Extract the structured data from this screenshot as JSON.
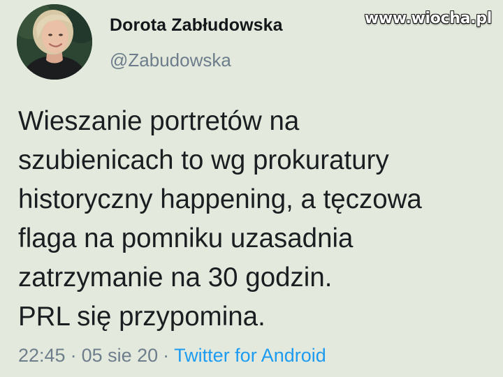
{
  "author": {
    "display_name": "Dorota Zabłudowska",
    "handle": "@Zabudowska",
    "avatar_icon": "profile-photo"
  },
  "watermark": "www.wiocha.pl",
  "tweet": {
    "lines": [
      "Wieszanie portretów na",
      "szubienicach to wg prokuratury",
      "historyczny happening, a tęczowa",
      "flaga na pomniku uzasadnia",
      "zatrzymanie na 30 godzin.",
      "PRL się przypomina."
    ]
  },
  "meta": {
    "time": "22:45",
    "separator": "·",
    "date": "05 sie 20",
    "source": "Twitter for Android"
  },
  "colors": {
    "background": "#e3eadd",
    "secondary_text": "#6d7d8b",
    "link": "#1d9bf0"
  }
}
